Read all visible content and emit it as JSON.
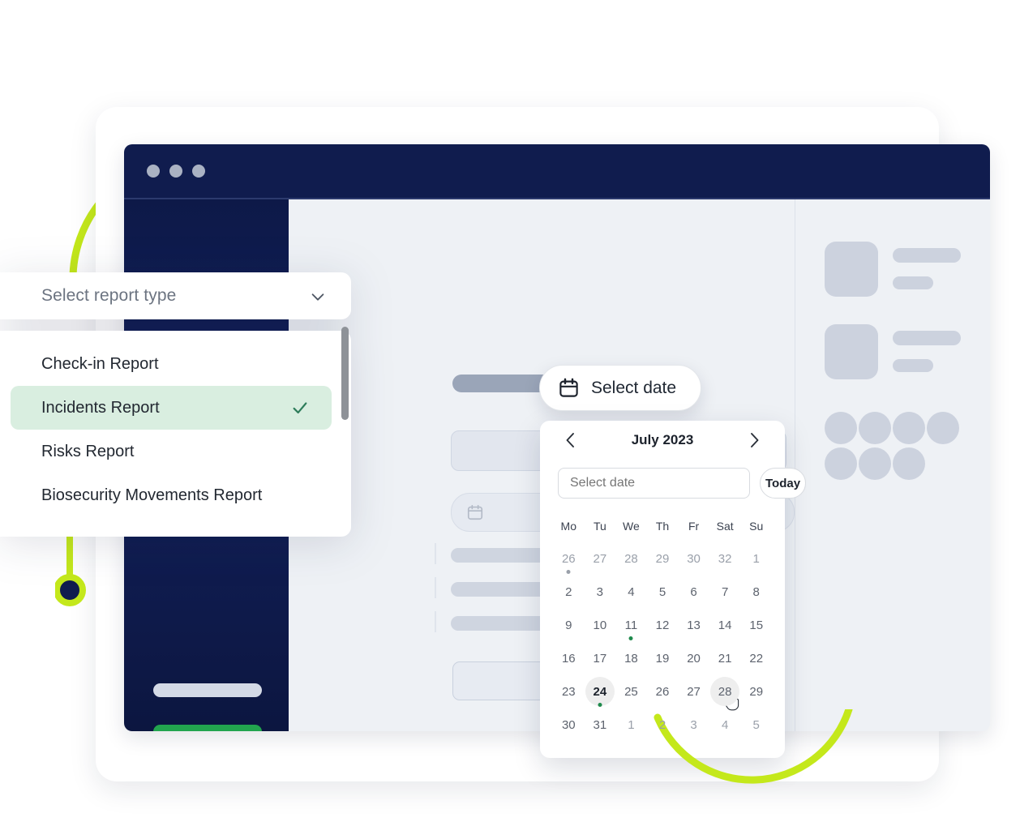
{
  "colors": {
    "navy": "#101c4e",
    "lime": "#c4e81b",
    "green": "#22a44e",
    "mint": "#d9eee0",
    "panel": "#eef1f5",
    "skeleton": "#ccd2de"
  },
  "window": {
    "traffic_lights": [
      "dot-1",
      "dot-2",
      "dot-3"
    ],
    "left_nav_items": [
      {
        "name": "nav-pill-1",
        "state": "inactive"
      },
      {
        "name": "nav-pill-2",
        "state": "active"
      },
      {
        "name": "nav-pill-3",
        "state": "inactive"
      }
    ]
  },
  "report_dropdown": {
    "placeholder": "Select report type",
    "chevron_icon": "chevron-down-icon",
    "options": [
      {
        "label": "Check-in Report",
        "selected": false
      },
      {
        "label": "Incidents Report",
        "selected": true
      },
      {
        "label": "Risks Report",
        "selected": false
      },
      {
        "label": "Biosecurity Movements Report",
        "selected": false
      }
    ],
    "check_icon": "check-icon",
    "scrollbar": "dropdown-scrollbar"
  },
  "select_date_button": {
    "label": "Select date",
    "icon": "calendar-icon"
  },
  "datepicker": {
    "month_label": "July 2023",
    "prev_icon": "chevron-left-icon",
    "next_icon": "chevron-right-icon",
    "input_placeholder": "Select date",
    "input_value": "",
    "today_label": "Today",
    "weekdays": [
      "Mo",
      "Tu",
      "We",
      "Th",
      "Fr",
      "Sat",
      "Su"
    ],
    "weeks": [
      [
        {
          "day": "26",
          "muted": true,
          "dot": "grey"
        },
        {
          "day": "27",
          "muted": true
        },
        {
          "day": "28",
          "muted": true
        },
        {
          "day": "29",
          "muted": true
        },
        {
          "day": "30",
          "muted": true
        },
        {
          "day": "32",
          "muted": true
        },
        {
          "day": "1",
          "muted": true
        }
      ],
      [
        {
          "day": "2"
        },
        {
          "day": "3"
        },
        {
          "day": "4"
        },
        {
          "day": "5"
        },
        {
          "day": "6"
        },
        {
          "day": "7"
        },
        {
          "day": "8"
        }
      ],
      [
        {
          "day": "9"
        },
        {
          "day": "10"
        },
        {
          "day": "11",
          "dot": "green"
        },
        {
          "day": "12"
        },
        {
          "day": "13"
        },
        {
          "day": "14"
        },
        {
          "day": "15"
        }
      ],
      [
        {
          "day": "16"
        },
        {
          "day": "17"
        },
        {
          "day": "18"
        },
        {
          "day": "19"
        },
        {
          "day": "20"
        },
        {
          "day": "21"
        },
        {
          "day": "22"
        }
      ],
      [
        {
          "day": "23"
        },
        {
          "day": "24",
          "selected": true,
          "circle": true,
          "dot": "green"
        },
        {
          "day": "25"
        },
        {
          "day": "26"
        },
        {
          "day": "27"
        },
        {
          "day": "28",
          "circle": true,
          "hovered": true
        },
        {
          "day": "29"
        }
      ],
      [
        {
          "day": "30"
        },
        {
          "day": "31"
        },
        {
          "day": "1",
          "muted": true
        },
        {
          "day": "2",
          "muted": true
        },
        {
          "day": "3",
          "muted": true
        },
        {
          "day": "4",
          "muted": true
        },
        {
          "day": "5",
          "muted": true
        }
      ]
    ],
    "cursor_icon": "pointer-cursor-icon"
  },
  "form_skeleton": {
    "title_bar": "content-title-placeholder",
    "select_chevron_icon": "chevron-down-icon",
    "date_field_icons": [
      "calendar-icon",
      "calendar-icon"
    ],
    "list_rows": [
      "row-1",
      "row-2",
      "row-3"
    ],
    "download_icon": "download-circle-icon"
  },
  "right_panel": {
    "cards": [
      {
        "thumb": "thumb-1",
        "bars": [
          "bar-long",
          "bar-short"
        ]
      },
      {
        "thumb": "thumb-2",
        "bars": [
          "bar-long",
          "bar-short"
        ]
      }
    ],
    "avatars_row_1": [
      "avatar-1",
      "avatar-2",
      "avatar-3",
      "avatar-4"
    ],
    "avatars_row_2": [
      "avatar-5",
      "avatar-6",
      "avatar-7"
    ]
  },
  "decorations": {
    "arc_top": "lime-arc-top",
    "arc_bottom": "lime-arc-bottom",
    "pin": "lime-pin-marker"
  }
}
